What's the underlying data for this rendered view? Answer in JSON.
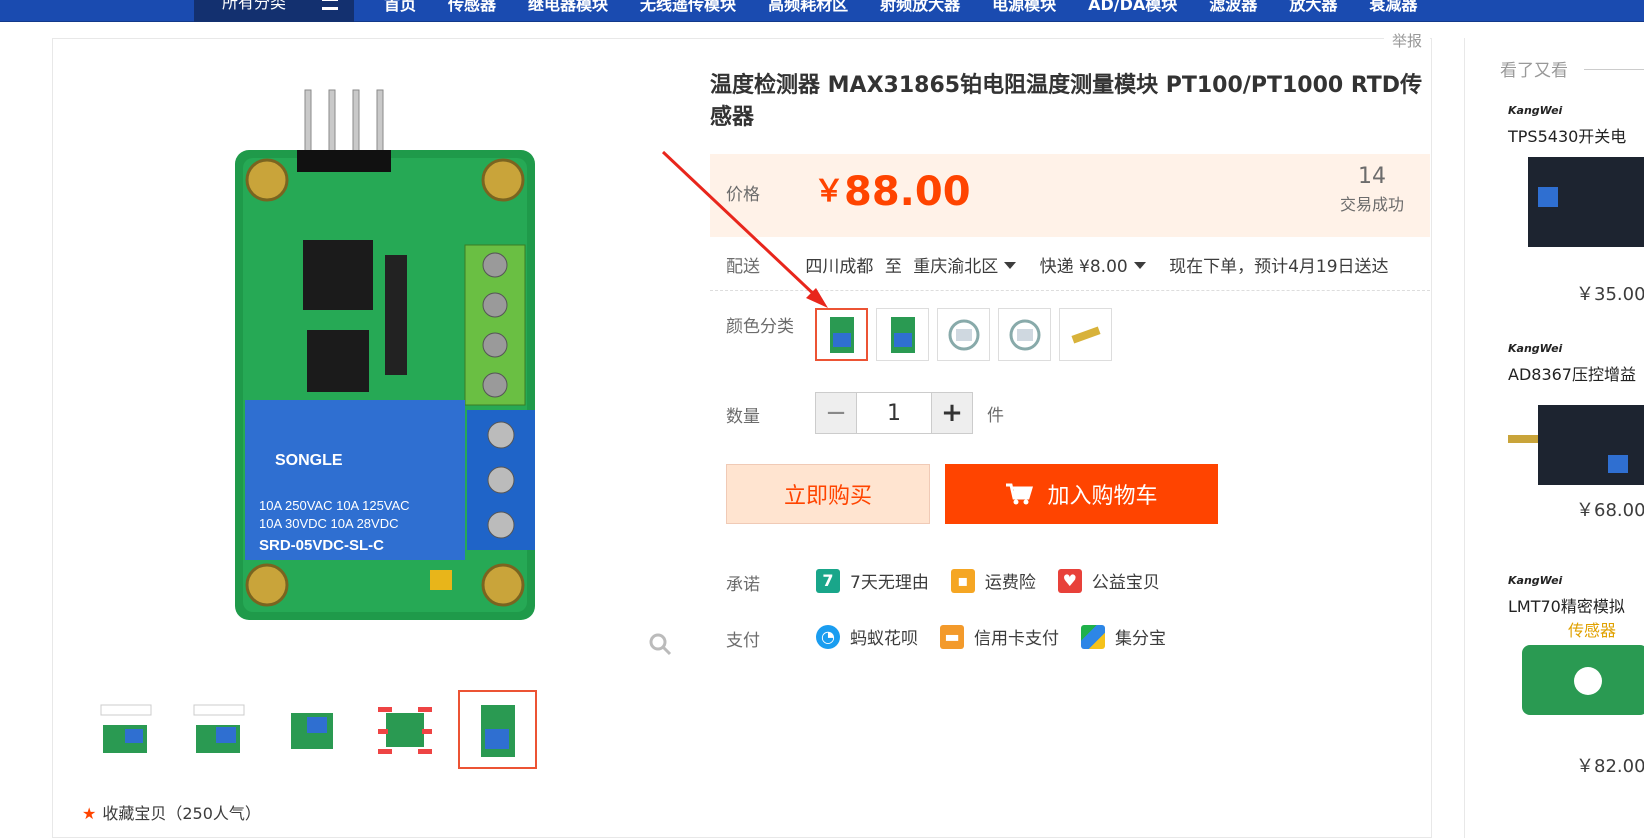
{
  "nav": {
    "all_categories": "所有分类",
    "items": [
      "首页",
      "传感器",
      "继电器模块",
      "无线遥传模块",
      "高频耗材区",
      "射频放大器",
      "电源模块",
      "AD/DA模块",
      "滤波器",
      "放大器",
      "衰减器"
    ]
  },
  "report_label": "举报",
  "product": {
    "title": "温度检测器 MAX31865铂电阻温度测量模块 PT100/PT1000 RTD传感器",
    "price_label": "价格",
    "currency": "￥",
    "price": "88.00",
    "sold_count": "14",
    "sold_label": "交易成功",
    "shipping_label": "配送",
    "ship_from": "四川成都",
    "ship_to_word": "至",
    "ship_to": "重庆渝北区",
    "express": "快递 ¥8.00",
    "delivery_estimate": "现在下单，预计4月19日送达",
    "color_label": "颜色分类",
    "quantity_label": "数量",
    "quantity": "1",
    "unit": "件",
    "buy_now": "立即购买",
    "add_to_cart": "加入购物车",
    "promise_label": "承诺",
    "promises": [
      "7天无理由",
      "运费险",
      "公益宝贝"
    ],
    "payment_label": "支付",
    "payments": [
      "蚂蚁花呗",
      "信用卡支付",
      "集分宝"
    ],
    "favorite": "收藏宝贝（250人气）"
  },
  "recommend": {
    "heading": "看了又看",
    "items": [
      {
        "brand": "KangWei",
        "name": "TPS5430开关电",
        "price": "￥35.00"
      },
      {
        "brand": "KangWei",
        "name": "AD8367压控增益",
        "price": "￥68.00"
      },
      {
        "brand": "KangWei",
        "name": "LMT70精密模拟",
        "name2": "传感器",
        "price": "￥82.00"
      }
    ]
  },
  "colors": {
    "accent": "#ff4400",
    "nav_bg": "#1a4bb0",
    "selection_border": "#ec5334",
    "annotation_arrow": "#e8261c"
  }
}
